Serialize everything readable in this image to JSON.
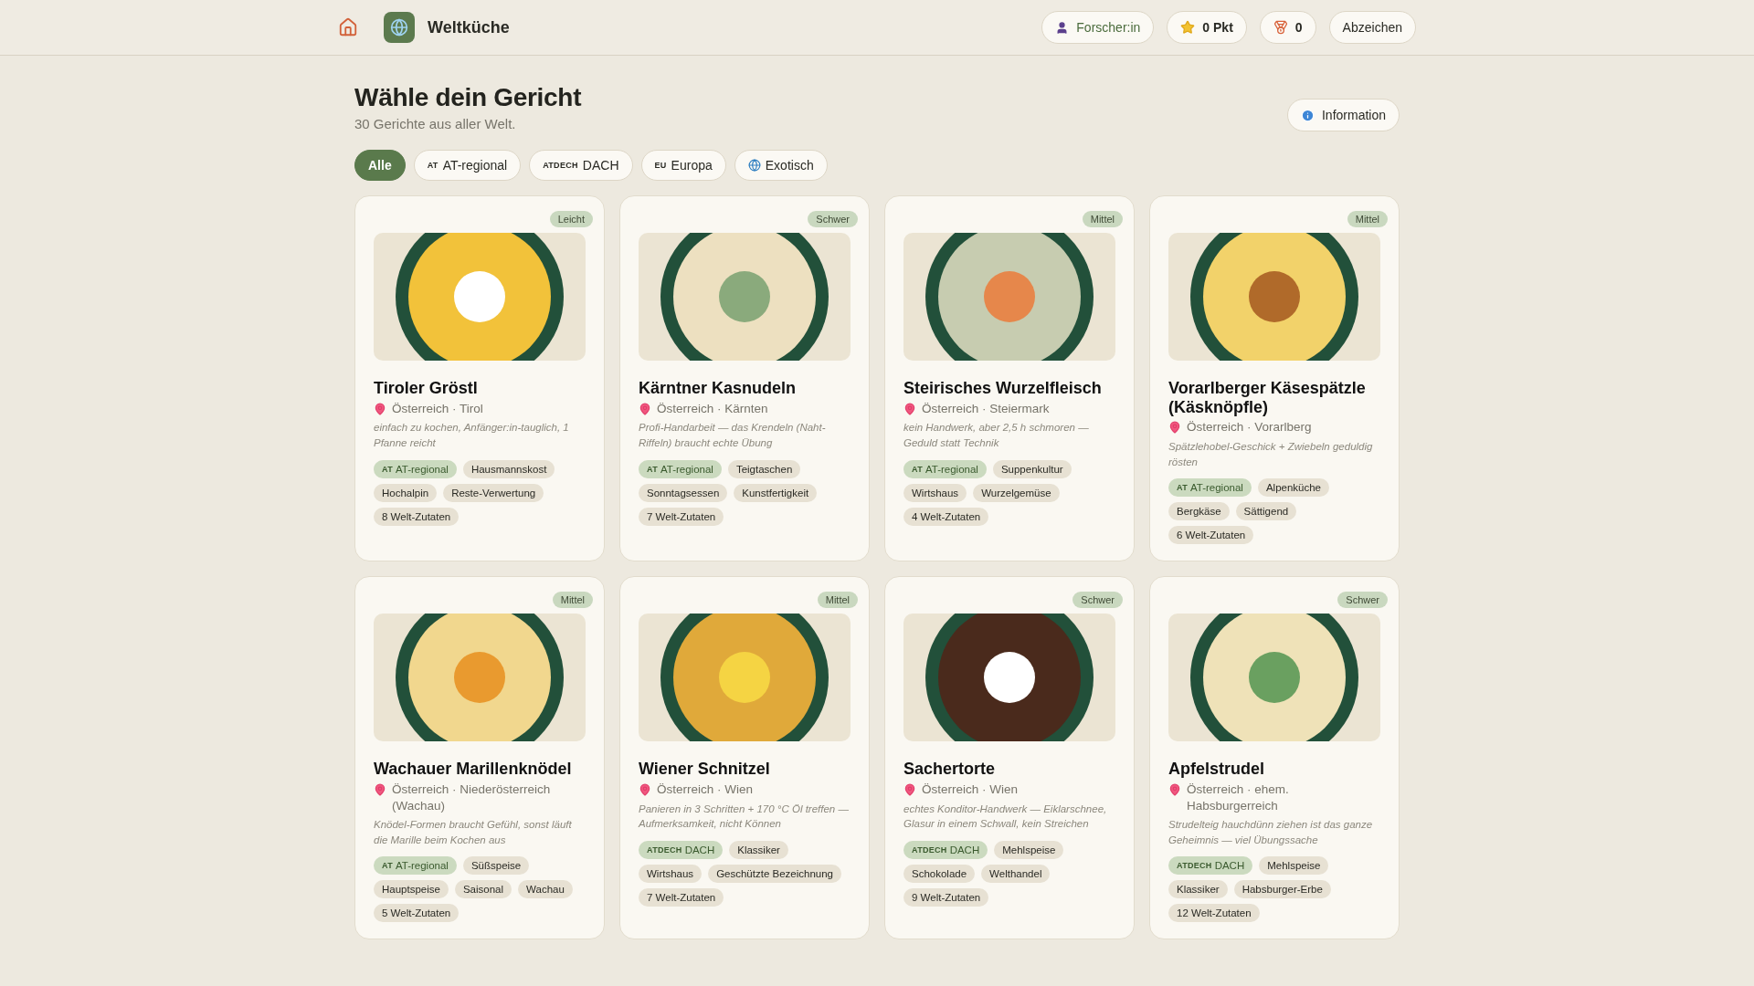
{
  "header": {
    "brand": "Weltküche",
    "user_button": "Forscher:in",
    "points": "0 Pkt",
    "medals": "0",
    "badges_button": "Abzeichen"
  },
  "page": {
    "title": "Wähle dein Gericht",
    "subtitle": "30 Gerichte aus aller Welt.",
    "info_button": "Information"
  },
  "filters": [
    {
      "kind": "plain",
      "label": "Alle",
      "selected": true
    },
    {
      "kind": "flag",
      "flag": "AT",
      "label": "AT-regional",
      "selected": false
    },
    {
      "kind": "flag",
      "flag": "ATDECH",
      "label": "DACH",
      "selected": false
    },
    {
      "kind": "flag",
      "flag": "EU",
      "label": "Europa",
      "selected": false
    },
    {
      "kind": "globe",
      "label": "Exotisch",
      "selected": false
    }
  ],
  "dishes": [
    {
      "name": "Tiroler Gröstl",
      "difficulty": "Leicht",
      "location": "Österreich · Tirol",
      "note": "einfach zu kochen, Anfänger:in-tauglich, 1 Pfanne reicht",
      "tags": [
        {
          "kind": "region",
          "flag": "AT",
          "label": "AT-regional"
        },
        {
          "kind": "plain",
          "label": "Hausmannskost"
        },
        {
          "kind": "plain",
          "label": "Hochalpin"
        },
        {
          "kind": "plain",
          "label": "Reste-Verwertung"
        },
        {
          "kind": "plain",
          "label": "8 Welt-Zutaten"
        }
      ]
    },
    {
      "name": "Kärntner Kasnudeln",
      "difficulty": "Schwer",
      "location": "Österreich · Kärnten",
      "note": "Profi-Handarbeit — das Krendeln (Naht-Riffeln) braucht echte Übung",
      "tags": [
        {
          "kind": "region",
          "flag": "AT",
          "label": "AT-regional"
        },
        {
          "kind": "plain",
          "label": "Teigtaschen"
        },
        {
          "kind": "plain",
          "label": "Sonntagsessen"
        },
        {
          "kind": "plain",
          "label": "Kunstfertigkeit"
        },
        {
          "kind": "plain",
          "label": "7 Welt-Zutaten"
        }
      ]
    },
    {
      "name": "Steirisches Wurzelfleisch",
      "difficulty": "Mittel",
      "location": "Österreich · Steiermark",
      "note": "kein Handwerk, aber 2,5 h schmoren — Geduld statt Technik",
      "tags": [
        {
          "kind": "region",
          "flag": "AT",
          "label": "AT-regional"
        },
        {
          "kind": "plain",
          "label": "Suppenkultur"
        },
        {
          "kind": "plain",
          "label": "Wirtshaus"
        },
        {
          "kind": "plain",
          "label": "Wurzelgemüse"
        },
        {
          "kind": "plain",
          "label": "4 Welt-Zutaten"
        }
      ]
    },
    {
      "name": "Vorarlberger Käsespätzle (Käsknöpfle)",
      "difficulty": "Mittel",
      "location": "Österreich · Vorarlberg",
      "note": "Spätzlehobel-Geschick + Zwiebeln geduldig rösten",
      "tags": [
        {
          "kind": "region",
          "flag": "AT",
          "label": "AT-regional"
        },
        {
          "kind": "plain",
          "label": "Alpenküche"
        },
        {
          "kind": "plain",
          "label": "Bergkäse"
        },
        {
          "kind": "plain",
          "label": "Sättigend"
        },
        {
          "kind": "plain",
          "label": "6 Welt-Zutaten"
        }
      ]
    },
    {
      "name": "Wachauer Marillenknödel",
      "difficulty": "Mittel",
      "location": "Österreich · Niederösterreich (Wachau)",
      "note": "Knödel-Formen braucht Gefühl, sonst läuft die Marille beim Kochen aus",
      "tags": [
        {
          "kind": "region",
          "flag": "AT",
          "label": "AT-regional"
        },
        {
          "kind": "plain",
          "label": "Süßspeise"
        },
        {
          "kind": "plain",
          "label": "Hauptspeise"
        },
        {
          "kind": "plain",
          "label": "Saisonal"
        },
        {
          "kind": "plain",
          "label": "Wachau"
        },
        {
          "kind": "plain",
          "label": "5 Welt-Zutaten"
        }
      ]
    },
    {
      "name": "Wiener Schnitzel",
      "difficulty": "Mittel",
      "location": "Österreich · Wien",
      "note": "Panieren in 3 Schritten + 170 °C Öl treffen — Aufmerksamkeit, nicht Können",
      "tags": [
        {
          "kind": "region",
          "flag": "ATDECH",
          "label": "DACH"
        },
        {
          "kind": "plain",
          "label": "Klassiker"
        },
        {
          "kind": "plain",
          "label": "Wirtshaus"
        },
        {
          "kind": "plain",
          "label": "Geschützte Bezeichnung"
        },
        {
          "kind": "plain",
          "label": "7 Welt-Zutaten"
        }
      ]
    },
    {
      "name": "Sachertorte",
      "difficulty": "Schwer",
      "location": "Österreich · Wien",
      "note": "echtes Konditor-Handwerk — Eiklarschnee, Glasur in einem Schwall, kein Streichen",
      "tags": [
        {
          "kind": "region",
          "flag": "ATDECH",
          "label": "DACH"
        },
        {
          "kind": "plain",
          "label": "Mehlspeise"
        },
        {
          "kind": "plain",
          "label": "Schokolade"
        },
        {
          "kind": "plain",
          "label": "Welthandel"
        },
        {
          "kind": "plain",
          "label": "9 Welt-Zutaten"
        }
      ]
    },
    {
      "name": "Apfelstrudel",
      "difficulty": "Schwer",
      "location": "Österreich · ehem. Habsburgerreich",
      "note": "Strudelteig hauchdünn ziehen ist das ganze Geheimnis — viel Übungssache",
      "tags": [
        {
          "kind": "region",
          "flag": "ATDECH",
          "label": "DACH"
        },
        {
          "kind": "plain",
          "label": "Mehlspeise"
        },
        {
          "kind": "plain",
          "label": "Klassiker"
        },
        {
          "kind": "plain",
          "label": "Habsburger-Erbe"
        },
        {
          "kind": "plain",
          "label": "12 Welt-Zutaten"
        }
      ]
    }
  ]
}
